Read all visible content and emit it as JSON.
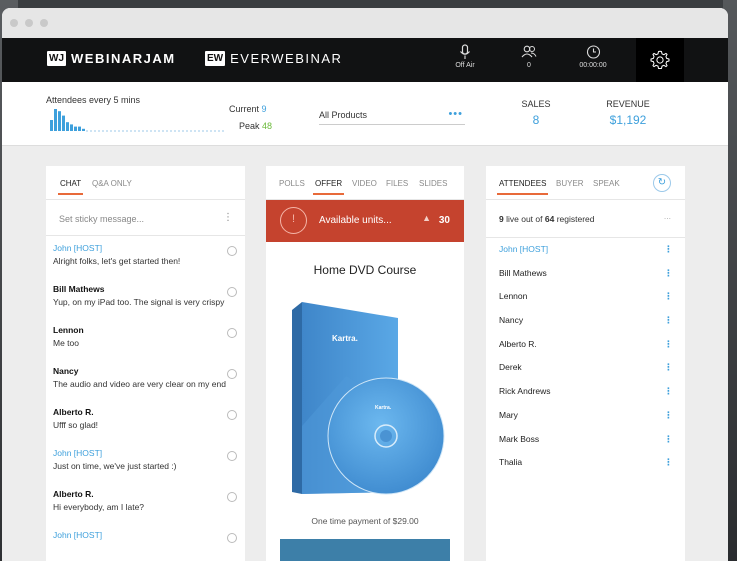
{
  "brand": {
    "webinarjam_badge": "WJ",
    "webinarjam": "WEBINARJAM",
    "everwebinar_badge": "EW",
    "everwebinar": "EVERWEBINAR"
  },
  "topbar": {
    "mic_label": "Off Air",
    "users_count": "0",
    "timer": "00:00:00"
  },
  "stats": {
    "attendees_label": "Attendees every 5 mins",
    "current_label": "Current",
    "current_value": "9",
    "peak_label": "Peak",
    "peak_value": "48",
    "products_value": "All Products",
    "products_more": "•••",
    "sales_label": "SALES",
    "sales_value": "8",
    "revenue_label": "REVENUE",
    "revenue_value": "$1,192",
    "spark_bars": [
      5,
      10,
      9,
      7,
      4,
      3,
      2,
      2,
      1
    ]
  },
  "chat": {
    "tabs": [
      "CHAT",
      "Q&A ONLY"
    ],
    "sticky_placeholder": "Set sticky message...",
    "kebab": "⋮",
    "messages": [
      {
        "name": "John [HOST]",
        "host": true,
        "text": "Alright folks, let's get started then!"
      },
      {
        "name": "Bill Mathews",
        "host": false,
        "text": "Yup, on my iPad too. The signal is very crispy"
      },
      {
        "name": "Lennon",
        "host": false,
        "text": "Me too"
      },
      {
        "name": "Nancy",
        "host": false,
        "text": "The audio and video are very clear on my end"
      },
      {
        "name": "Alberto R.",
        "host": false,
        "text": "Ufff so glad!"
      },
      {
        "name": "John [HOST]",
        "host": true,
        "text": "Just on time, we've just started :)"
      },
      {
        "name": "Alberto R.",
        "host": false,
        "text": "Hi everybody, am I late?"
      },
      {
        "name": "John [HOST]",
        "host": true,
        "text": ""
      }
    ]
  },
  "offer": {
    "tabs": [
      "POLLS",
      "OFFER",
      "VIDEO",
      "FILES",
      "SLIDES"
    ],
    "available_label": "Available units...",
    "available_count": "30",
    "product_title": "Home DVD Course",
    "dvd_brand": "Kartra.",
    "payment": "One time payment of $29.00"
  },
  "attendees": {
    "tabs": [
      "ATTENDEES",
      "BUYER",
      "SPEAK"
    ],
    "live_count": "9",
    "live_text": "live out of",
    "registered_count": "64",
    "registered_text": "registered",
    "ellipsis": "...",
    "kebab": "⋮",
    "list": [
      {
        "name": "John [HOST]",
        "host": true
      },
      {
        "name": "Bill Mathews",
        "host": false
      },
      {
        "name": "Lennon",
        "host": false
      },
      {
        "name": "Nancy",
        "host": false
      },
      {
        "name": "Alberto R.",
        "host": false
      },
      {
        "name": "Derek",
        "host": false
      },
      {
        "name": "Rick Andrews",
        "host": false
      },
      {
        "name": "Mary",
        "host": false
      },
      {
        "name": "Mark Boss",
        "host": false
      },
      {
        "name": "Thalia",
        "host": false
      }
    ]
  },
  "colors": {
    "accent_blue": "#3ea0dc",
    "offer_red": "#c5432e",
    "tab_underline": "#e86a3a",
    "peak_green": "#6bba3a"
  }
}
